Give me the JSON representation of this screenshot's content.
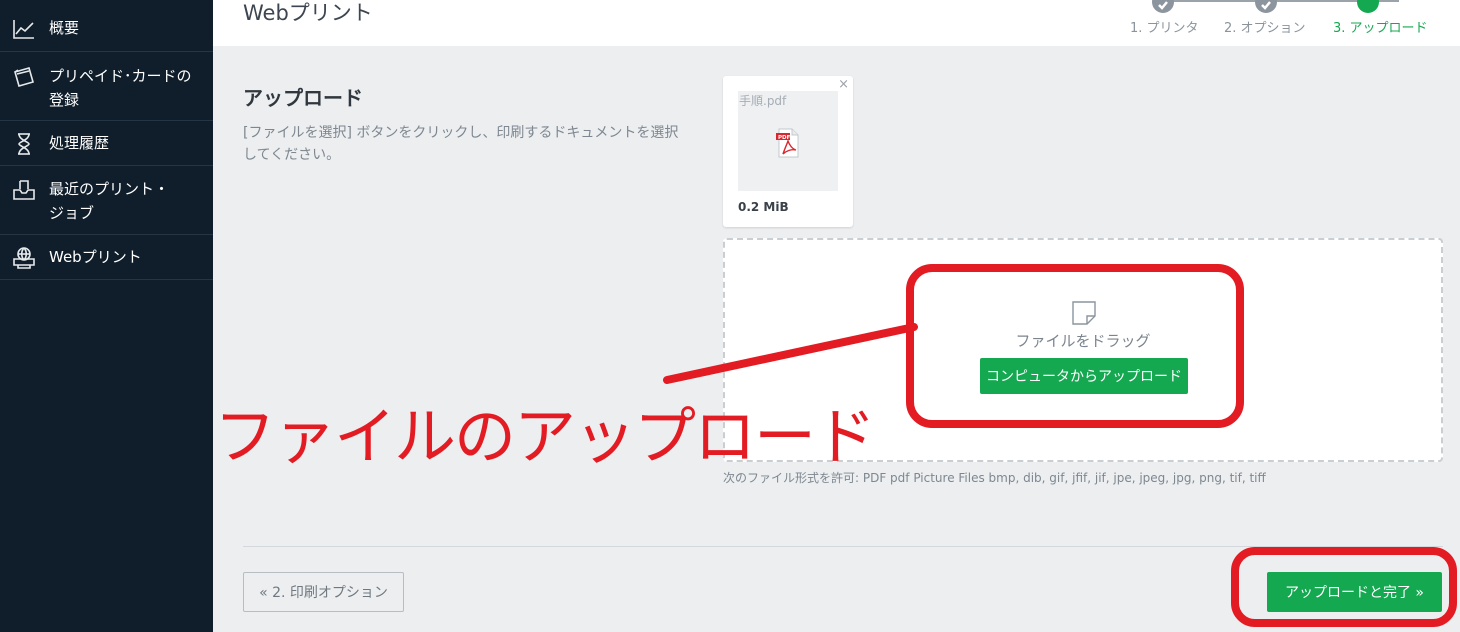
{
  "sidebar": {
    "items": [
      {
        "label": "概要",
        "icon": "chart-line-icon"
      },
      {
        "label": "プリペイド･カードの登録",
        "icon": "card-icon"
      },
      {
        "label": "処理履歴",
        "icon": "hourglass-icon"
      },
      {
        "label": "最近のプリント・ジョブ",
        "icon": "inbox-icon"
      },
      {
        "label": "Webプリント",
        "icon": "printer-globe-icon"
      }
    ]
  },
  "header": {
    "title": "Webプリント",
    "steps": [
      {
        "label": "1. プリンタ",
        "state": "done"
      },
      {
        "label": "2. オプション",
        "state": "done"
      },
      {
        "label": "3. アップロード",
        "state": "active"
      }
    ]
  },
  "main": {
    "section_title": "アップロード",
    "section_desc": "[ファイルを選択] ボタンをクリックし、印刷するドキュメントを選択してください。",
    "file": {
      "name": "手順.pdf",
      "size": "0.2 MiB",
      "close": "×"
    },
    "dropzone": {
      "text": "ファイルをドラッグ",
      "button": "コンピュータからアップロード"
    },
    "allowed": "次のファイル形式を許可: PDF pdf Picture Files bmp, dib, gif, jfif, jif, jpe, jpeg, jpg, png, tif, tiff",
    "back_button": "« 2. 印刷オプション",
    "finish_button": "アップロードと完了 »"
  },
  "annotation": {
    "text": "ファイルのアップロード",
    "color": "#e31b23"
  },
  "colors": {
    "accent": "#14a850",
    "sidebar_bg": "#101e2b",
    "annotation": "#e31b23"
  }
}
